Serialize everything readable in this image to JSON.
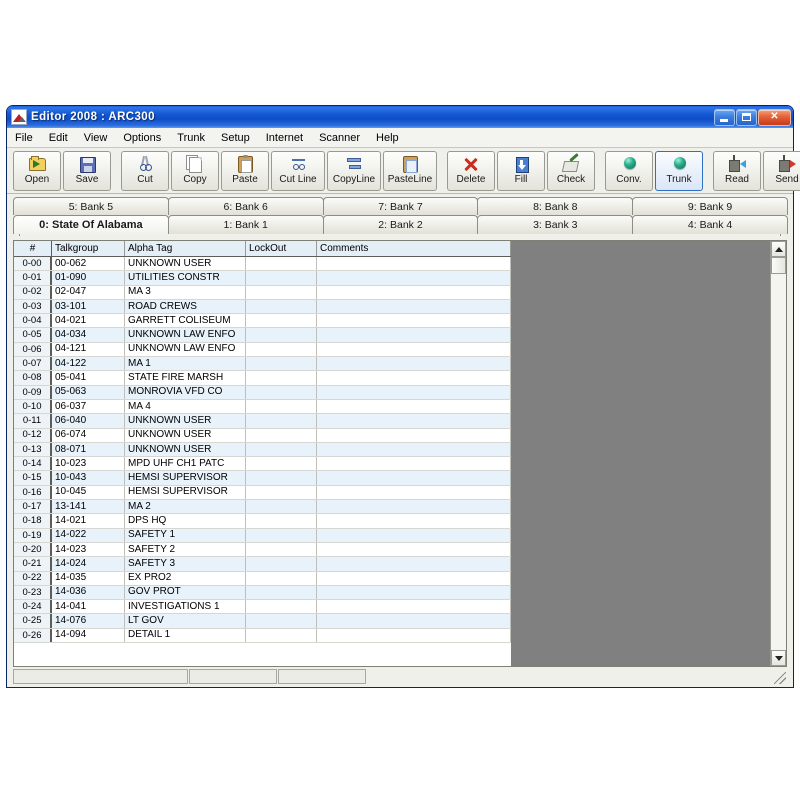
{
  "window": {
    "title": "Editor 2008 : ARC300",
    "app_icon": "mountain-icon",
    "controls": {
      "minimize": "minimize-button",
      "maximize": "maximize-button",
      "close": "close-button"
    }
  },
  "menubar": {
    "items": [
      "File",
      "Edit",
      "View",
      "Options",
      "Trunk",
      "Setup",
      "Internet",
      "Scanner",
      "Help"
    ]
  },
  "toolbar": {
    "groups": [
      {
        "buttons": [
          {
            "label": "Open",
            "icon": "folder-open-icon",
            "selected": false
          },
          {
            "label": "Save",
            "icon": "floppy-disk-icon",
            "selected": false
          }
        ]
      },
      {
        "buttons": [
          {
            "label": "Cut",
            "icon": "scissors-icon",
            "selected": false
          },
          {
            "label": "Copy",
            "icon": "copy-pages-icon",
            "selected": false
          },
          {
            "label": "Paste",
            "icon": "clipboard-icon",
            "selected": false
          },
          {
            "label": "Cut Line",
            "icon": "cut-line-icon",
            "selected": false
          },
          {
            "label": "CopyLine",
            "icon": "copy-line-icon",
            "selected": false
          },
          {
            "label": "PasteLine",
            "icon": "paste-line-icon",
            "selected": false
          }
        ]
      },
      {
        "buttons": [
          {
            "label": "Delete",
            "icon": "red-x-icon",
            "selected": false
          },
          {
            "label": "Fill",
            "icon": "fill-down-icon",
            "selected": false
          },
          {
            "label": "Check",
            "icon": "check-brush-icon",
            "selected": false
          }
        ]
      },
      {
        "buttons": [
          {
            "label": "Conv.",
            "icon": "green-sphere-icon",
            "selected": false
          },
          {
            "label": "Trunk",
            "icon": "green-sphere-icon",
            "selected": true
          }
        ]
      },
      {
        "buttons": [
          {
            "label": "Read",
            "icon": "radio-read-icon",
            "selected": false
          },
          {
            "label": "Send",
            "icon": "radio-send-icon",
            "selected": false
          }
        ]
      }
    ]
  },
  "tabs": {
    "top_row": [
      {
        "label": "5: Bank 5",
        "active": false
      },
      {
        "label": "6: Bank 6",
        "active": false
      },
      {
        "label": "7: Bank 7",
        "active": false
      },
      {
        "label": "8: Bank 8",
        "active": false
      },
      {
        "label": "9: Bank 9",
        "active": false
      }
    ],
    "bottom_row": [
      {
        "label": "0: State Of Alabama",
        "active": true
      },
      {
        "label": "1: Bank 1",
        "active": false
      },
      {
        "label": "2: Bank 2",
        "active": false
      },
      {
        "label": "3: Bank 3",
        "active": false
      },
      {
        "label": "4: Bank 4",
        "active": false
      }
    ]
  },
  "grid": {
    "columns": [
      "#",
      "Talkgroup",
      "Alpha Tag",
      "LockOut",
      "Comments"
    ],
    "rows": [
      {
        "num": "0-00",
        "talkgroup": "00-062",
        "alpha": "UNKNOWN USER",
        "lockout": "",
        "comments": ""
      },
      {
        "num": "0-01",
        "talkgroup": "01-090",
        "alpha": "UTILITIES CONSTR",
        "lockout": "",
        "comments": ""
      },
      {
        "num": "0-02",
        "talkgroup": "02-047",
        "alpha": "MA 3",
        "lockout": "",
        "comments": ""
      },
      {
        "num": "0-03",
        "talkgroup": "03-101",
        "alpha": "ROAD CREWS",
        "lockout": "",
        "comments": ""
      },
      {
        "num": "0-04",
        "talkgroup": "04-021",
        "alpha": "GARRETT COLISEUM",
        "lockout": "",
        "comments": ""
      },
      {
        "num": "0-05",
        "talkgroup": "04-034",
        "alpha": "UNKNOWN LAW ENFO",
        "lockout": "",
        "comments": ""
      },
      {
        "num": "0-06",
        "talkgroup": "04-121",
        "alpha": "UNKNOWN LAW ENFO",
        "lockout": "",
        "comments": ""
      },
      {
        "num": "0-07",
        "talkgroup": "04-122",
        "alpha": "MA 1",
        "lockout": "",
        "comments": ""
      },
      {
        "num": "0-08",
        "talkgroup": "05-041",
        "alpha": "STATE FIRE MARSH",
        "lockout": "",
        "comments": ""
      },
      {
        "num": "0-09",
        "talkgroup": "05-063",
        "alpha": "MONROVIA VFD  CO",
        "lockout": "",
        "comments": ""
      },
      {
        "num": "0-10",
        "talkgroup": "06-037",
        "alpha": "MA 4",
        "lockout": "",
        "comments": ""
      },
      {
        "num": "0-11",
        "talkgroup": "06-040",
        "alpha": "UNKNOWN USER",
        "lockout": "",
        "comments": ""
      },
      {
        "num": "0-12",
        "talkgroup": "06-074",
        "alpha": "UNKNOWN USER",
        "lockout": "",
        "comments": ""
      },
      {
        "num": "0-13",
        "talkgroup": "08-071",
        "alpha": "UNKNOWN USER",
        "lockout": "",
        "comments": ""
      },
      {
        "num": "0-14",
        "talkgroup": "10-023",
        "alpha": "MPD UHF CH1 PATC",
        "lockout": "",
        "comments": ""
      },
      {
        "num": "0-15",
        "talkgroup": "10-043",
        "alpha": "HEMSI SUPERVISOR",
        "lockout": "",
        "comments": ""
      },
      {
        "num": "0-16",
        "talkgroup": "10-045",
        "alpha": "HEMSI SUPERVISOR",
        "lockout": "",
        "comments": ""
      },
      {
        "num": "0-17",
        "talkgroup": "13-141",
        "alpha": "MA 2",
        "lockout": "",
        "comments": ""
      },
      {
        "num": "0-18",
        "talkgroup": "14-021",
        "alpha": "DPS HQ",
        "lockout": "",
        "comments": ""
      },
      {
        "num": "0-19",
        "talkgroup": "14-022",
        "alpha": "SAFETY 1",
        "lockout": "",
        "comments": ""
      },
      {
        "num": "0-20",
        "talkgroup": "14-023",
        "alpha": "SAFETY 2",
        "lockout": "",
        "comments": ""
      },
      {
        "num": "0-21",
        "talkgroup": "14-024",
        "alpha": "SAFETY 3",
        "lockout": "",
        "comments": ""
      },
      {
        "num": "0-22",
        "talkgroup": "14-035",
        "alpha": "EX PRO2",
        "lockout": "",
        "comments": ""
      },
      {
        "num": "0-23",
        "talkgroup": "14-036",
        "alpha": "GOV PROT",
        "lockout": "",
        "comments": ""
      },
      {
        "num": "0-24",
        "talkgroup": "14-041",
        "alpha": "INVESTIGATIONS 1",
        "lockout": "",
        "comments": ""
      },
      {
        "num": "0-25",
        "talkgroup": "14-076",
        "alpha": "LT GOV",
        "lockout": "",
        "comments": ""
      },
      {
        "num": "0-26",
        "talkgroup": "14-094",
        "alpha": "DETAIL 1",
        "lockout": "",
        "comments": ""
      }
    ]
  },
  "statusbar": {
    "panels": [
      "",
      "",
      "",
      ""
    ]
  },
  "colors": {
    "titlebar_blue": "#1357d2",
    "window_border": "#0a246a",
    "row_stripe": "#e8f2fb",
    "header_blue": "#e4eef7",
    "empty_area_gray": "#808080",
    "selected_button_border": "#2f6fc4"
  }
}
